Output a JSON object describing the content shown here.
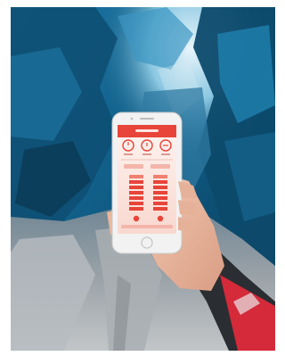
{
  "photo": {
    "scene": "ice-cave",
    "device": "smartphone",
    "app": {
      "title": "",
      "status_time": "",
      "accent_color": "#e8443a",
      "screen_color": "#fbe6e1"
    },
    "colors": {
      "ice_deep": "#0f4f73",
      "ice_mid": "#2b87b8",
      "ice_light": "#a9d6e8",
      "ground": "#8e959c",
      "jacket": "#d42a3a",
      "sleeve": "#26292c"
    }
  }
}
